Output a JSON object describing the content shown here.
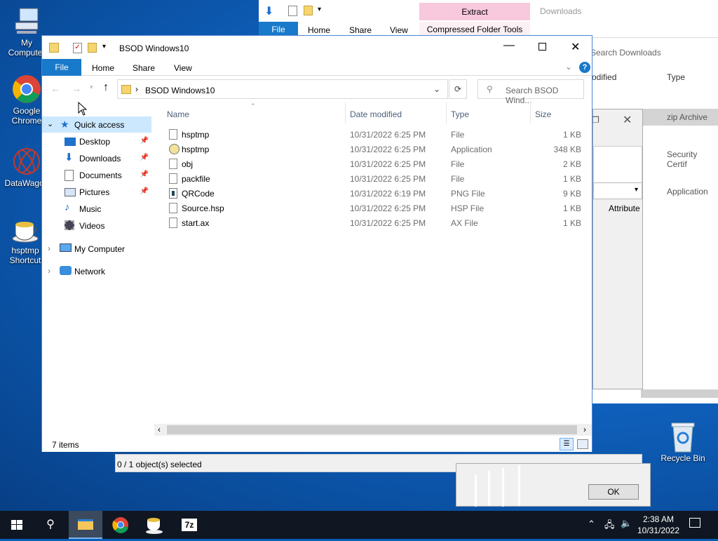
{
  "desktop": {
    "icons": [
      {
        "label": "My Computer"
      },
      {
        "label": "Google Chrome"
      },
      {
        "label": "DataWagon"
      },
      {
        "label": "hsptmp Shortcut"
      }
    ],
    "recycle_bin": "Recycle Bin"
  },
  "back_window": {
    "tabs": [
      "File",
      "Home",
      "Share",
      "View"
    ],
    "context_group": "Extract",
    "context_tab": "Compressed Folder Tools",
    "title": "Downloads",
    "search_placeholder": "Search Downloads",
    "col_modified": "odified",
    "col_type": "Type",
    "types": [
      "zip Archive",
      "Security Certif",
      "Application"
    ]
  },
  "dialog": {
    "attributes_col": "Attribute",
    "status": "0 / 1 object(s) selected",
    "ok": "OK"
  },
  "explorer": {
    "title": "BSOD Windows10",
    "tabs": [
      "File",
      "Home",
      "Share",
      "View"
    ],
    "address": "BSOD Windows10",
    "search_placeholder": "Search BSOD Wind...",
    "columns": {
      "name": "Name",
      "date": "Date modified",
      "type": "Type",
      "size": "Size"
    },
    "nav": {
      "quick_access": "Quick access",
      "items": [
        "Desktop",
        "Downloads",
        "Documents",
        "Pictures",
        "Music",
        "Videos"
      ],
      "my_computer": "My Computer",
      "network": "Network"
    },
    "files": [
      {
        "name": "hsptmp",
        "date": "10/31/2022 6:25 PM",
        "type": "File",
        "size": "1 KB",
        "icon": "blank-file-icon"
      },
      {
        "name": "hsptmp",
        "date": "10/31/2022 6:25 PM",
        "type": "Application",
        "size": "348 KB",
        "icon": "app-icon"
      },
      {
        "name": "obj",
        "date": "10/31/2022 6:25 PM",
        "type": "File",
        "size": "2 KB",
        "icon": "blank-file-icon"
      },
      {
        "name": "packfile",
        "date": "10/31/2022 6:25 PM",
        "type": "File",
        "size": "1 KB",
        "icon": "blank-file-icon"
      },
      {
        "name": "QRCode",
        "date": "10/31/2022 6:19 PM",
        "type": "PNG File",
        "size": "9 KB",
        "icon": "image-file-icon"
      },
      {
        "name": "Source.hsp",
        "date": "10/31/2022 6:25 PM",
        "type": "HSP File",
        "size": "1 KB",
        "icon": "blank-file-icon"
      },
      {
        "name": "start.ax",
        "date": "10/31/2022 6:25 PM",
        "type": "AX File",
        "size": "1 KB",
        "icon": "blank-file-icon"
      }
    ],
    "status": "7 items"
  },
  "taskbar": {
    "time": "2:38 AM",
    "date": "10/31/2022"
  }
}
